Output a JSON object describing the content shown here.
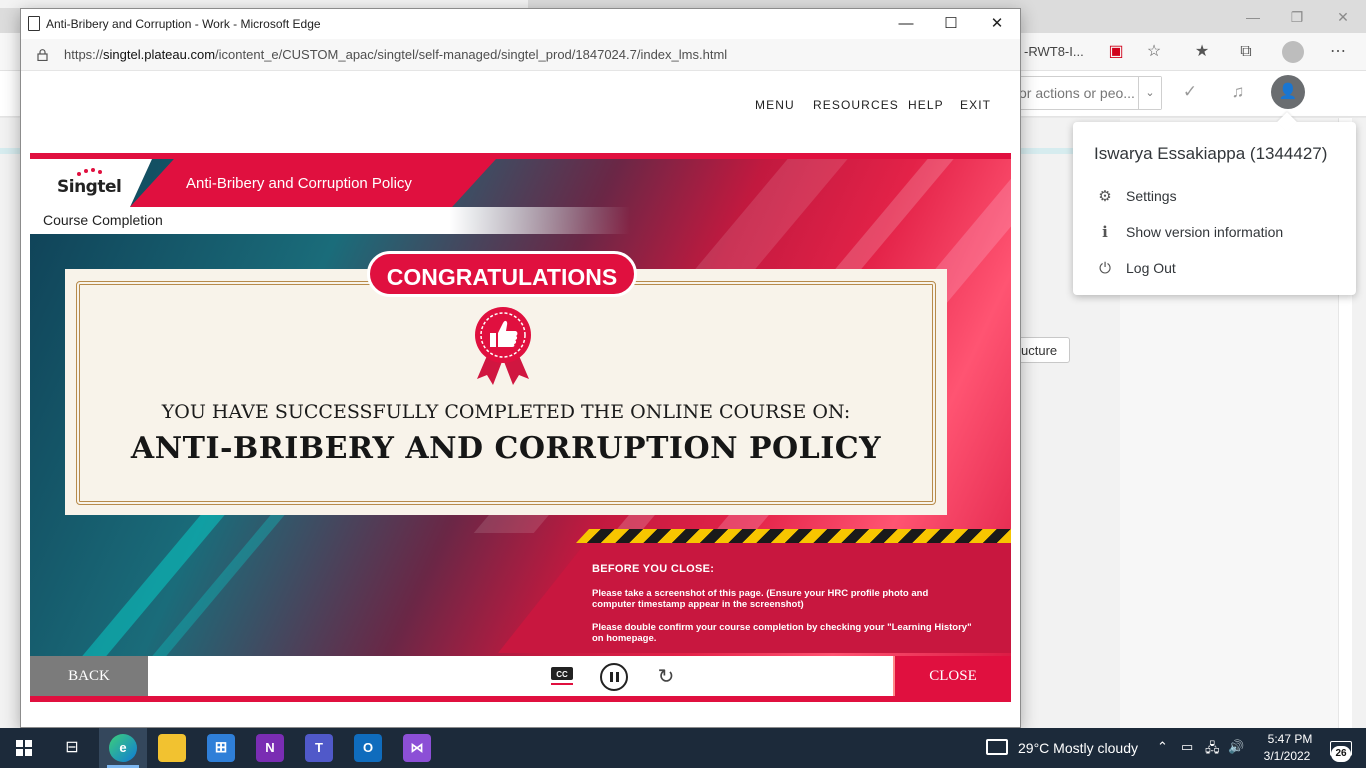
{
  "background_browser": {
    "address_fragment": "-RWT8-I...",
    "search_placeholder": "or actions or peo...",
    "button_fragment": "ucture"
  },
  "profile_menu": {
    "name": "Iswarya Essakiappa (1344427)",
    "items": [
      {
        "label": "Settings",
        "icon": "gear-icon"
      },
      {
        "label": "Show version information",
        "icon": "info-icon"
      },
      {
        "label": "Log Out",
        "icon": "power-icon"
      }
    ]
  },
  "popup": {
    "window_title": "Anti-Bribery and Corruption - Work - Microsoft Edge",
    "url_prefix": "https://",
    "url_host": "singtel.plateau.com",
    "url_path": "/icontent_e/CUSTOM_apac/singtel/self-managed/singtel_prod/1847024.7/index_lms.html",
    "nav": [
      "MENU",
      "RESOURCES",
      "HELP",
      "EXIT"
    ]
  },
  "course": {
    "logo_text": "Singtel",
    "title": "Anti-Bribery and Corruption Policy",
    "section_label": "Course Completion",
    "congrats": "CONGRATULATIONS",
    "line1": "YOU HAVE SUCCESSFULLY COMPLETED THE ONLINE COURSE ON:",
    "line2": "ANTI-BRIBERY AND CORRUPTION POLICY",
    "notice_title": "BEFORE YOU CLOSE:",
    "notice_1": "Please take a screenshot of this page. (Ensure your  HRC profile photo and computer timestamp appear in the screenshot)",
    "notice_2": "Please double confirm your course completion by checking your \"Learning History\" on homepage.",
    "back_label": "BACK",
    "close_label": "CLOSE",
    "cc_label": "CC"
  },
  "taskbar": {
    "weather": "29°C  Mostly cloudy",
    "time": "5:47 PM",
    "date": "3/1/2022",
    "notifications": "26"
  },
  "colors": {
    "brand_red": "#e0103f",
    "taskbar": "#1c2a3a"
  }
}
